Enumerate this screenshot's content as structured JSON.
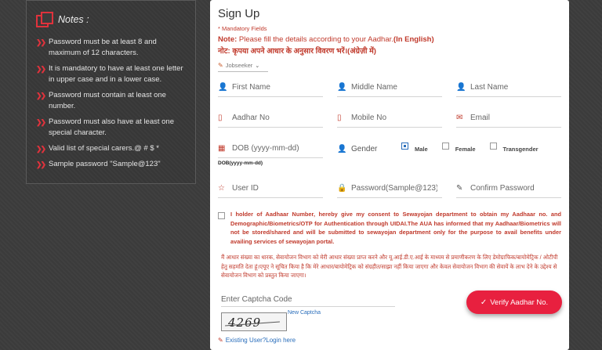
{
  "notes": {
    "title": "Notes :",
    "items": [
      "Password must be at least 8 and maximum of 12 characters.",
      "It is mandatory to have at least one letter in upper case and in a lower case.",
      "Password must contain at least one number.",
      "Password must also have at least one special character.",
      "Valid list of special carers.@ # $ *",
      "Sample password \"Sample@123\""
    ]
  },
  "form": {
    "title": "Sign Up",
    "mandatory": "* Mandatory Fields",
    "note_en_prefix": "Note:",
    "note_en_text": " Please fill the details according to your Aadhar.",
    "note_en_suffix": "(In English)",
    "note_hi": "नोट: कृपया अपने आधार के अनुसार विवरण भरें।(अंग्रेज़ी में)",
    "role": "Jobseeker",
    "fields": {
      "first_name": "First Name",
      "middle_name": "Middle Name",
      "last_name": "Last Name",
      "aadhar": "Aadhar No",
      "mobile": "Mobile No",
      "email": "Email",
      "dob": "DOB (yyyy-mm-dd)",
      "dob_hint": "DOB(yyyy-mm-dd)",
      "gender": "Gender",
      "user_id": "User ID",
      "password": "Password(Sample@123)",
      "confirm_password": "Confirm Password",
      "captcha": "Enter Captcha Code"
    },
    "gender_options": [
      "Male",
      "Female",
      "Transgender"
    ],
    "gender_selected": "Male",
    "consent_en": "I holder of Aadhaar Number, hereby give my consent to Sewayojan department to obtain my Aadhaar no. and Demographic/Biometrics/OTP for Authentication through UIDAI.The AUA has informed that my Aadhaar/Biometrics will not be stored/shared and will be submitted to sewayojan department only for the purpose to avail benefits under availing services of sewayojan portal.",
    "consent_hi": "मैं आधार संख्या का धारक, सेवायोजन विभाग को मेरी आधार संख्या प्राप्त करने और यू.आई.डी.ए.आई के माध्यम से प्रमाणीकरण के लिए डेमोग्राफिक/बायोमेट्रिक / ओटीपी हेतु सहमति देता हूं।एयूए ने सूचित किया है कि मेरे आधार/बायोमेट्रिक को संग्रहीत/साझा नहीं किया जाएगा और केवल सेवायोजन विभाग की सेवायें के लाभ देने के उद्देश्य से सेवायोजन विभाग को प्रस्तुत किया जाएगा।",
    "captcha_value": "4269",
    "new_captcha": "New Captcha",
    "existing_user": "Existing User?Login here",
    "verify_button": "Verify Aadhar No."
  },
  "colors": {
    "accent": "#e8203f",
    "note_red": "#c0392b",
    "link_blue": "#2a6ebb"
  }
}
